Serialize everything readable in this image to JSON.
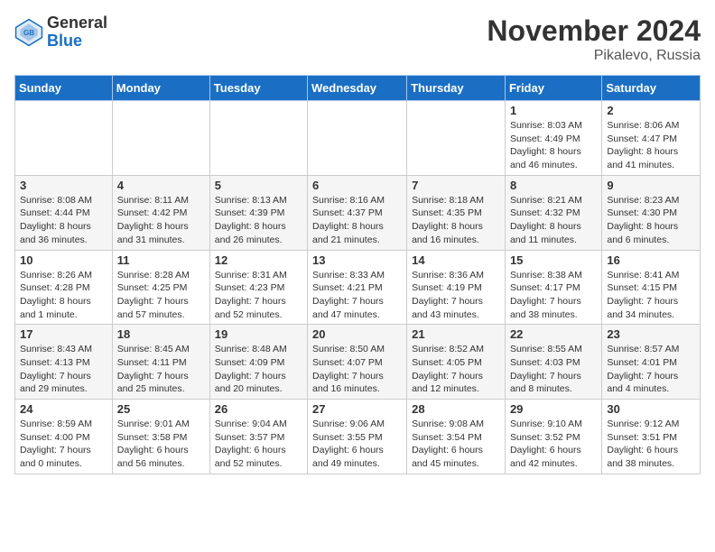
{
  "header": {
    "logo_general": "General",
    "logo_blue": "Blue",
    "month_title": "November 2024",
    "location": "Pikalevo, Russia"
  },
  "days_of_week": [
    "Sunday",
    "Monday",
    "Tuesday",
    "Wednesday",
    "Thursday",
    "Friday",
    "Saturday"
  ],
  "weeks": [
    {
      "days": [
        {
          "num": "",
          "info": ""
        },
        {
          "num": "",
          "info": ""
        },
        {
          "num": "",
          "info": ""
        },
        {
          "num": "",
          "info": ""
        },
        {
          "num": "",
          "info": ""
        },
        {
          "num": "1",
          "info": "Sunrise: 8:03 AM\nSunset: 4:49 PM\nDaylight: 8 hours and 46 minutes."
        },
        {
          "num": "2",
          "info": "Sunrise: 8:06 AM\nSunset: 4:47 PM\nDaylight: 8 hours and 41 minutes."
        }
      ]
    },
    {
      "days": [
        {
          "num": "3",
          "info": "Sunrise: 8:08 AM\nSunset: 4:44 PM\nDaylight: 8 hours and 36 minutes."
        },
        {
          "num": "4",
          "info": "Sunrise: 8:11 AM\nSunset: 4:42 PM\nDaylight: 8 hours and 31 minutes."
        },
        {
          "num": "5",
          "info": "Sunrise: 8:13 AM\nSunset: 4:39 PM\nDaylight: 8 hours and 26 minutes."
        },
        {
          "num": "6",
          "info": "Sunrise: 8:16 AM\nSunset: 4:37 PM\nDaylight: 8 hours and 21 minutes."
        },
        {
          "num": "7",
          "info": "Sunrise: 8:18 AM\nSunset: 4:35 PM\nDaylight: 8 hours and 16 minutes."
        },
        {
          "num": "8",
          "info": "Sunrise: 8:21 AM\nSunset: 4:32 PM\nDaylight: 8 hours and 11 minutes."
        },
        {
          "num": "9",
          "info": "Sunrise: 8:23 AM\nSunset: 4:30 PM\nDaylight: 8 hours and 6 minutes."
        }
      ]
    },
    {
      "days": [
        {
          "num": "10",
          "info": "Sunrise: 8:26 AM\nSunset: 4:28 PM\nDaylight: 8 hours and 1 minute."
        },
        {
          "num": "11",
          "info": "Sunrise: 8:28 AM\nSunset: 4:25 PM\nDaylight: 7 hours and 57 minutes."
        },
        {
          "num": "12",
          "info": "Sunrise: 8:31 AM\nSunset: 4:23 PM\nDaylight: 7 hours and 52 minutes."
        },
        {
          "num": "13",
          "info": "Sunrise: 8:33 AM\nSunset: 4:21 PM\nDaylight: 7 hours and 47 minutes."
        },
        {
          "num": "14",
          "info": "Sunrise: 8:36 AM\nSunset: 4:19 PM\nDaylight: 7 hours and 43 minutes."
        },
        {
          "num": "15",
          "info": "Sunrise: 8:38 AM\nSunset: 4:17 PM\nDaylight: 7 hours and 38 minutes."
        },
        {
          "num": "16",
          "info": "Sunrise: 8:41 AM\nSunset: 4:15 PM\nDaylight: 7 hours and 34 minutes."
        }
      ]
    },
    {
      "days": [
        {
          "num": "17",
          "info": "Sunrise: 8:43 AM\nSunset: 4:13 PM\nDaylight: 7 hours and 29 minutes."
        },
        {
          "num": "18",
          "info": "Sunrise: 8:45 AM\nSunset: 4:11 PM\nDaylight: 7 hours and 25 minutes."
        },
        {
          "num": "19",
          "info": "Sunrise: 8:48 AM\nSunset: 4:09 PM\nDaylight: 7 hours and 20 minutes."
        },
        {
          "num": "20",
          "info": "Sunrise: 8:50 AM\nSunset: 4:07 PM\nDaylight: 7 hours and 16 minutes."
        },
        {
          "num": "21",
          "info": "Sunrise: 8:52 AM\nSunset: 4:05 PM\nDaylight: 7 hours and 12 minutes."
        },
        {
          "num": "22",
          "info": "Sunrise: 8:55 AM\nSunset: 4:03 PM\nDaylight: 7 hours and 8 minutes."
        },
        {
          "num": "23",
          "info": "Sunrise: 8:57 AM\nSunset: 4:01 PM\nDaylight: 7 hours and 4 minutes."
        }
      ]
    },
    {
      "days": [
        {
          "num": "24",
          "info": "Sunrise: 8:59 AM\nSunset: 4:00 PM\nDaylight: 7 hours and 0 minutes."
        },
        {
          "num": "25",
          "info": "Sunrise: 9:01 AM\nSunset: 3:58 PM\nDaylight: 6 hours and 56 minutes."
        },
        {
          "num": "26",
          "info": "Sunrise: 9:04 AM\nSunset: 3:57 PM\nDaylight: 6 hours and 52 minutes."
        },
        {
          "num": "27",
          "info": "Sunrise: 9:06 AM\nSunset: 3:55 PM\nDaylight: 6 hours and 49 minutes."
        },
        {
          "num": "28",
          "info": "Sunrise: 9:08 AM\nSunset: 3:54 PM\nDaylight: 6 hours and 45 minutes."
        },
        {
          "num": "29",
          "info": "Sunrise: 9:10 AM\nSunset: 3:52 PM\nDaylight: 6 hours and 42 minutes."
        },
        {
          "num": "30",
          "info": "Sunrise: 9:12 AM\nSunset: 3:51 PM\nDaylight: 6 hours and 38 minutes."
        }
      ]
    }
  ]
}
